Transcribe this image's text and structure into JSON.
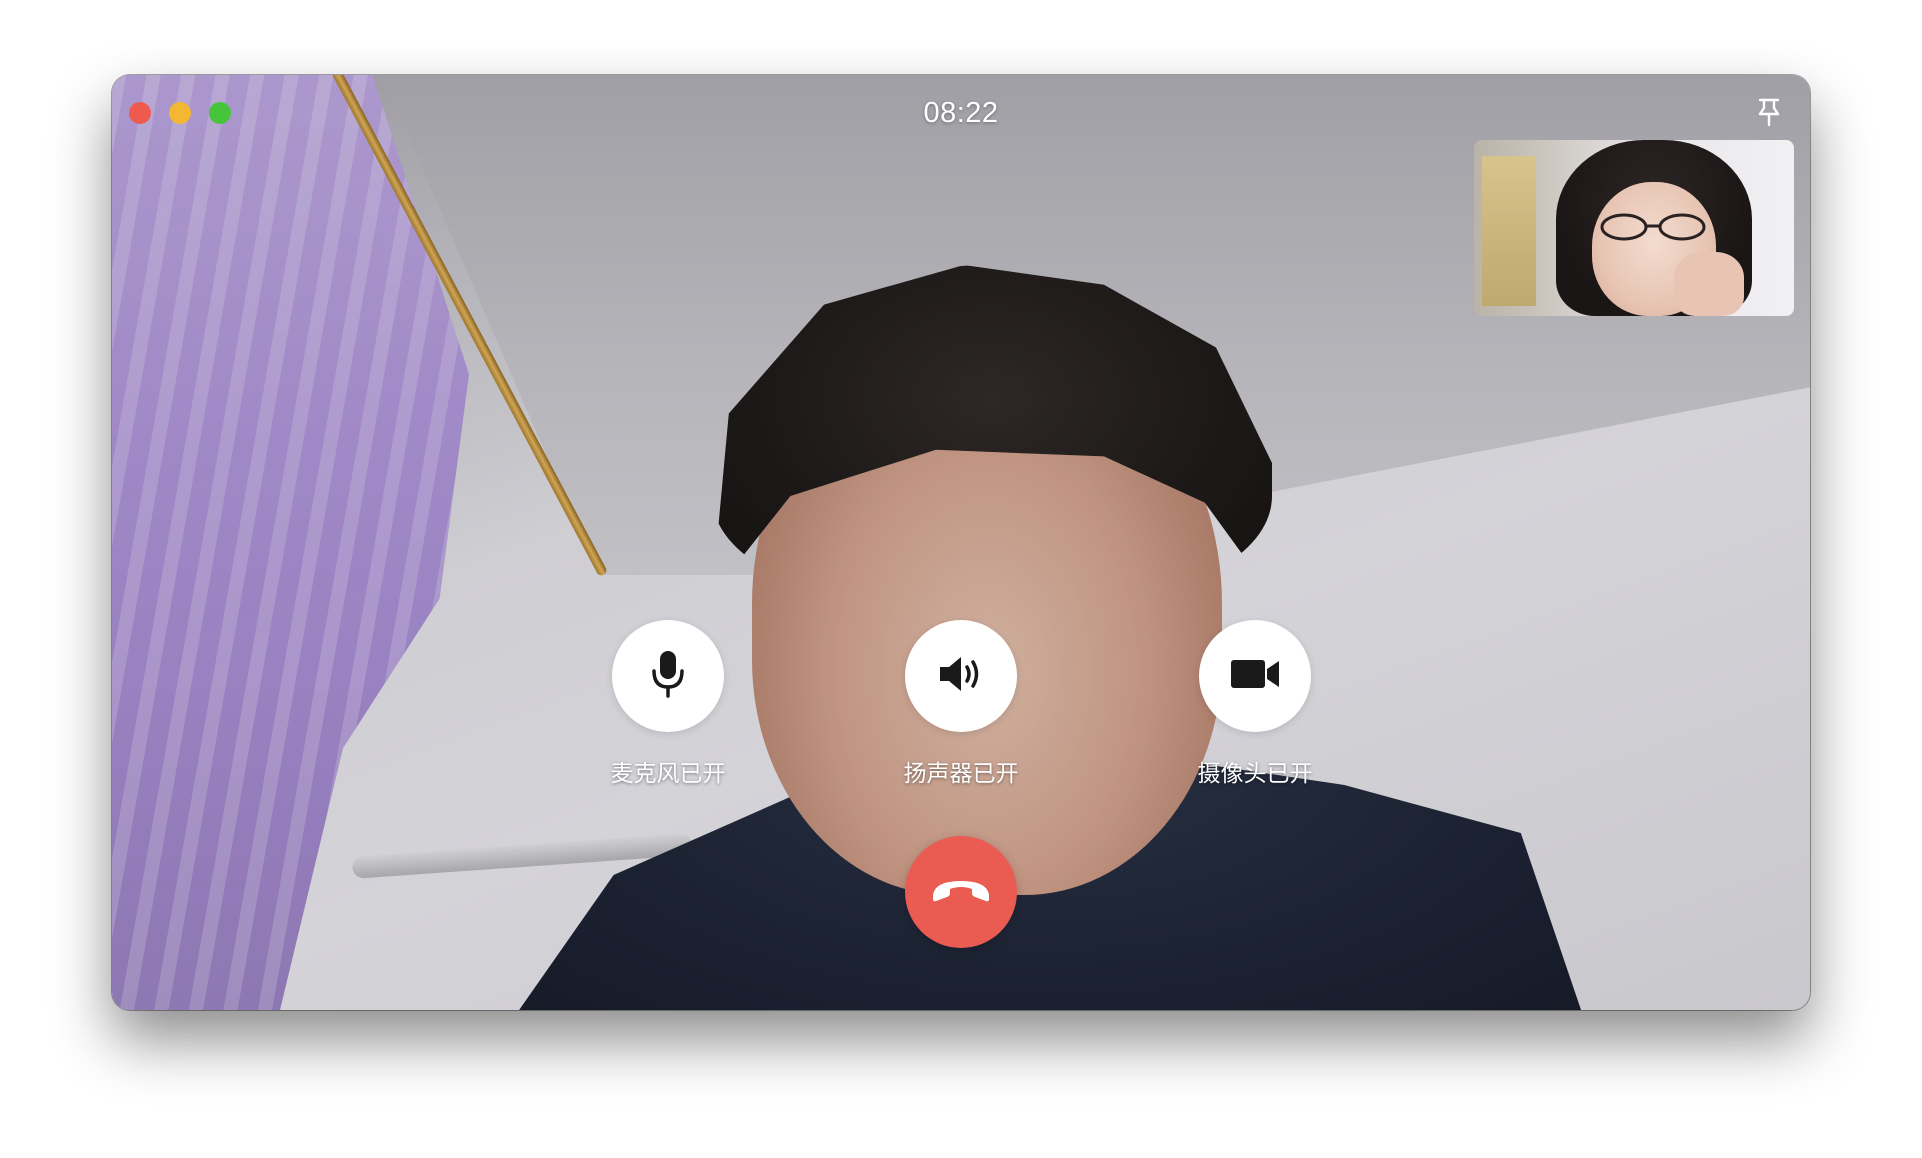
{
  "window": {
    "traffic_lights": [
      {
        "name": "close",
        "color": "#ee5a4e"
      },
      {
        "name": "minimize",
        "color": "#f4b731"
      },
      {
        "name": "maximize",
        "color": "#46c43c"
      }
    ]
  },
  "header": {
    "timer": "08:22",
    "pin_icon": "pin-icon"
  },
  "controls": {
    "microphone": {
      "label": "麦克风已开",
      "icon": "microphone-icon"
    },
    "speaker": {
      "label": "扬声器已开",
      "icon": "speaker-icon"
    },
    "camera": {
      "label": "摄像头已开",
      "icon": "video-camera-icon"
    },
    "hangup": {
      "icon": "phone-hangup-icon",
      "color": "#ea5b52"
    }
  }
}
